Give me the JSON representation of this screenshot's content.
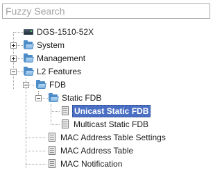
{
  "search": {
    "placeholder": "Fuzzy Search"
  },
  "tree": {
    "root": "DGS-1510-52X",
    "system": "System",
    "management": "Management",
    "l2_features": "L2 Features",
    "fdb": "FDB",
    "static_fdb": "Static FDB",
    "unicast_static_fdb": "Unicast Static FDB",
    "multicast_static_fdb": "Multicast Static FDB",
    "mac_table_settings": "MAC Address Table Settings",
    "mac_table": "MAC Address Table",
    "mac_notification": "MAC Notification"
  },
  "selected": "Unicast Static FDB",
  "colors": {
    "selection": "#4a6fc4",
    "folder": "#4d8cc7"
  }
}
